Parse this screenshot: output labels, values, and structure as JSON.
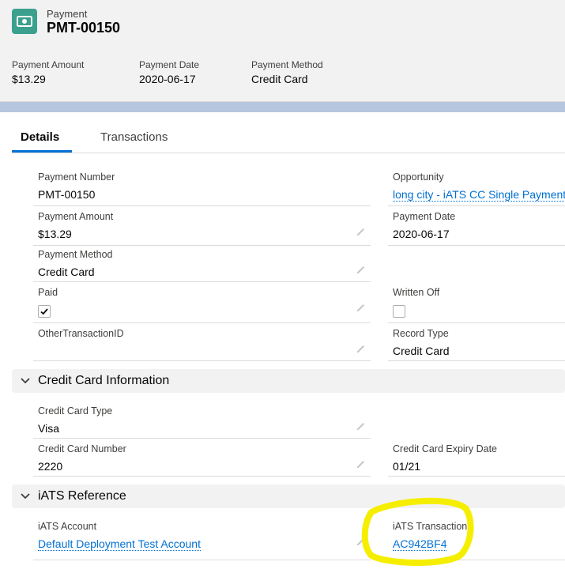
{
  "header": {
    "object_label": "Payment",
    "record_name": "PMT-00150",
    "icon": "payment-icon",
    "icon_color": "#3ba08e",
    "fields": [
      {
        "label": "Payment Amount",
        "value": "$13.29"
      },
      {
        "label": "Payment Date",
        "value": "2020-06-17"
      },
      {
        "label": "Payment Method",
        "value": "Credit Card"
      }
    ]
  },
  "tabs": [
    {
      "label": "Details",
      "active": true
    },
    {
      "label": "Transactions",
      "active": false
    }
  ],
  "details": {
    "payment_number": {
      "label": "Payment Number",
      "value": "PMT-00150"
    },
    "opportunity": {
      "label": "Opportunity",
      "value": "long city - iATS CC Single Payment"
    },
    "payment_amount": {
      "label": "Payment Amount",
      "value": "$13.29"
    },
    "payment_date": {
      "label": "Payment Date",
      "value": "2020-06-17"
    },
    "payment_method": {
      "label": "Payment Method",
      "value": "Credit Card"
    },
    "paid": {
      "label": "Paid",
      "checked": true
    },
    "written_off": {
      "label": "Written Off",
      "checked": false
    },
    "other_transaction_id": {
      "label": "OtherTransactionID",
      "value": ""
    },
    "record_type": {
      "label": "Record Type",
      "value": "Credit Card"
    }
  },
  "credit_card_section": {
    "title": "Credit Card Information",
    "card_type": {
      "label": "Credit Card Type",
      "value": "Visa"
    },
    "card_number": {
      "label": "Credit Card Number",
      "value": "2220"
    },
    "expiry": {
      "label": "Credit Card Expiry Date",
      "value": "01/21"
    }
  },
  "iats_section": {
    "title": "iATS Reference",
    "account": {
      "label": "iATS Account",
      "value": "Default Deployment Test Account"
    },
    "transaction": {
      "label": "iATS Transaction",
      "value": "AC942BF4"
    }
  },
  "colors": {
    "link": "#0070d2",
    "active_tab": "#0070d2",
    "highlight": "#f5ee00"
  }
}
